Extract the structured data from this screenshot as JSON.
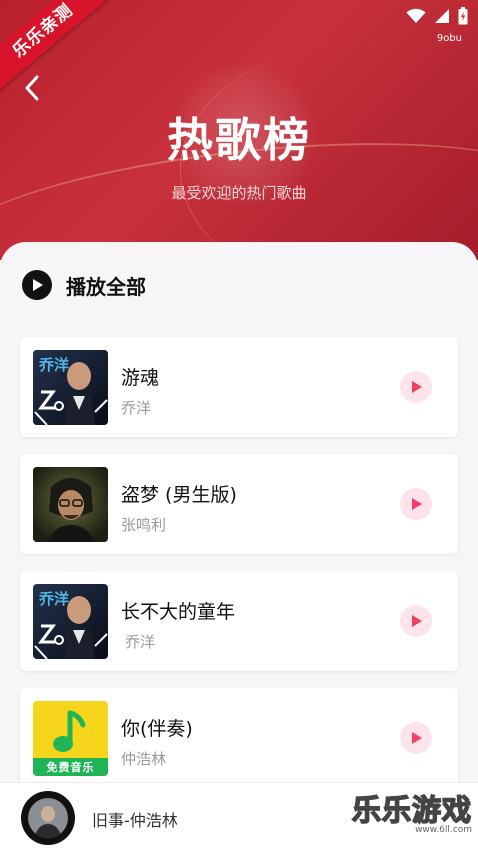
{
  "watermark_corner": "乐乐亲测",
  "status_bar": {
    "carrier": "9obu"
  },
  "header": {
    "title": "热歌榜",
    "subtitle": "最受欢迎的热门歌曲"
  },
  "play_all": {
    "label": "播放全部"
  },
  "songs": [
    {
      "title": "游魂",
      "artist": "乔洋",
      "cover": "album-cover-qiaoyang"
    },
    {
      "title": "盗梦 (男生版)",
      "artist": "张鸣利",
      "cover": "album-cover-portrait"
    },
    {
      "title": "长不大的童年",
      "artist": "乔洋",
      "cover": "album-cover-qiaoyang"
    },
    {
      "title": "你(伴奏)",
      "artist": "仲浩林",
      "cover": "album-cover-music-app",
      "cover_text": "免费音乐"
    }
  ],
  "mini_player": {
    "now_playing": "旧事-仲浩林"
  },
  "site_watermark": {
    "text": "乐乐游戏",
    "url": "www.6ll.com"
  },
  "colors": {
    "header_red": "#c8313c",
    "play_pink_bg": "#fde3ea",
    "play_pink_icon": "#f0406a",
    "music_app_yellow": "#f7d51d",
    "music_app_green": "#1fb455"
  }
}
